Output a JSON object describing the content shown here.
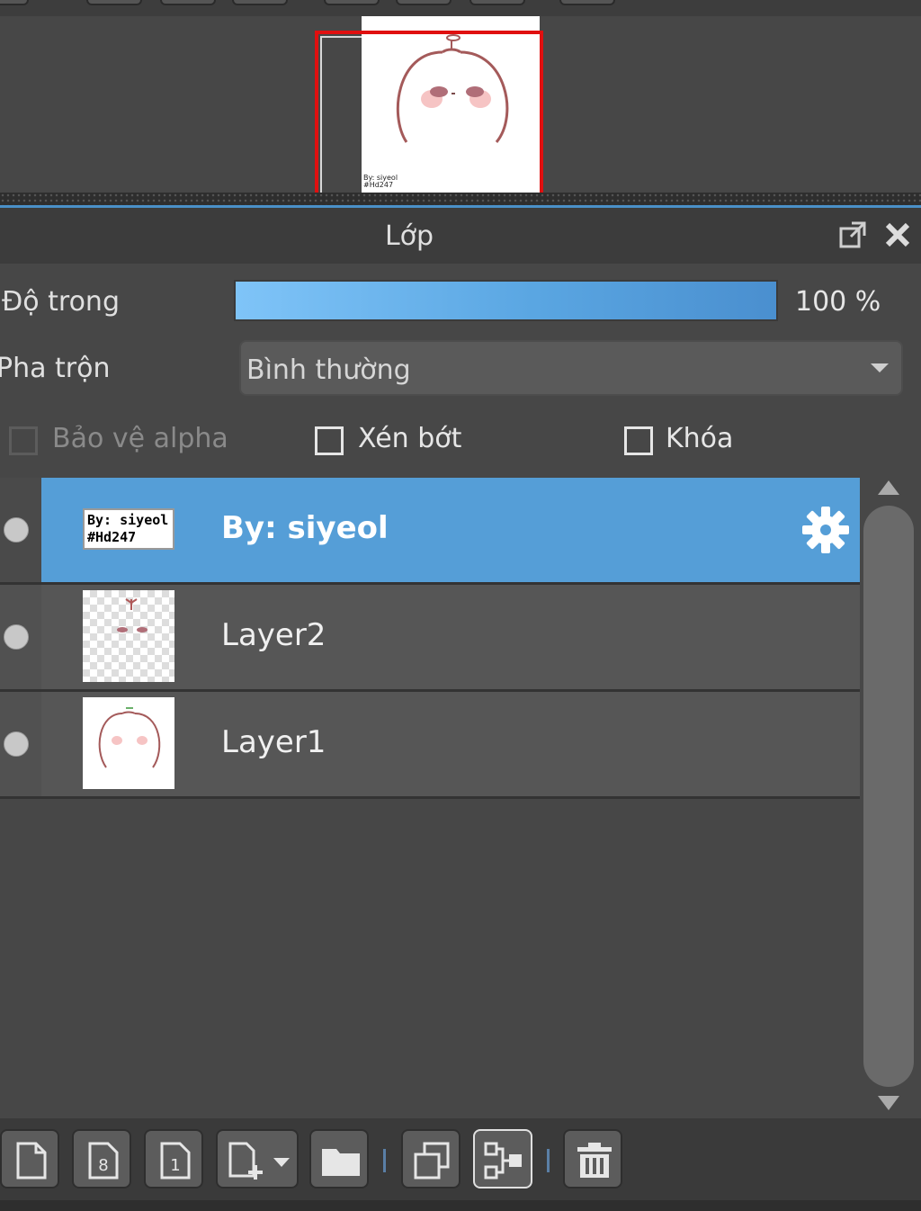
{
  "panel": {
    "title": "Lớp",
    "popout_icon": "popout-icon",
    "close_icon": "close-icon"
  },
  "navigator": {
    "signature_line1": "By: siyeol",
    "signature_line2": "#Hd247"
  },
  "properties": {
    "opacity_label": "Độ trong",
    "opacity_value": "100 %",
    "opacity_fraction": 1.0,
    "blend_label": "Pha trộn",
    "blend_value": "Bình thường",
    "protect_alpha_label": "Bảo vệ alpha",
    "clip_label": "Xén bớt",
    "lock_label": "Khóa"
  },
  "layers": [
    {
      "name": "By: siyeol",
      "thumb_line1": "By: siyeol",
      "thumb_line2": "#Hd247",
      "selected": true
    },
    {
      "name": "Layer2",
      "selected": false
    },
    {
      "name": "Layer1",
      "selected": false
    }
  ],
  "toolbar_icons": [
    "new-layer-icon",
    "new-8bit-layer-icon",
    "new-1bit-layer-icon",
    "add-layer-menu-icon",
    "folder-icon",
    "duplicate-icon",
    "merge-down-icon",
    "delete-icon"
  ],
  "colors": {
    "selected_row": "#559ed7",
    "opacity_bar": "#6fb8f0",
    "navigator_frame": "#e01010"
  }
}
